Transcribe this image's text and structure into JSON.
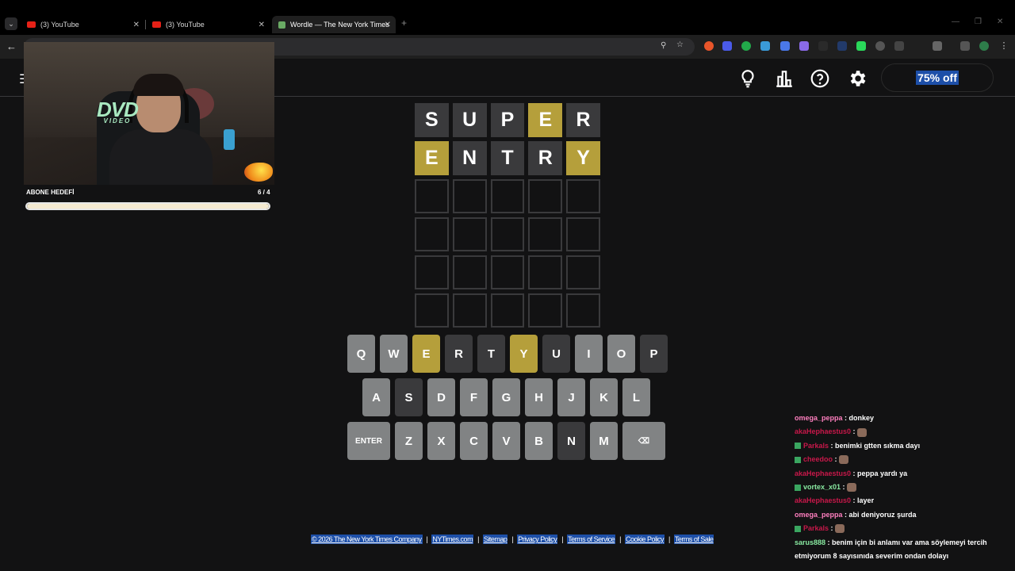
{
  "browser": {
    "tabs": [
      {
        "title": "(3) YouTube",
        "favicon_color": "#e62117"
      },
      {
        "title": "(3) YouTube",
        "favicon_color": "#e62117"
      },
      {
        "title": "Wordle — The New York Times",
        "favicon_color": "#6aaa64",
        "active": true
      }
    ]
  },
  "header": {
    "offer_label": "75% off"
  },
  "colors": {
    "correct": "#b59f3b",
    "present": "#b59f3b",
    "absent": "#3a3a3c",
    "unused_key": "#818384",
    "background": "#121213"
  },
  "board": {
    "rows": [
      {
        "letters": [
          "S",
          "U",
          "P",
          "E",
          "R"
        ],
        "states": [
          "absent",
          "absent",
          "absent",
          "present",
          "absent"
        ]
      },
      {
        "letters": [
          "E",
          "N",
          "T",
          "R",
          "Y"
        ],
        "states": [
          "present",
          "absent",
          "absent",
          "absent",
          "present"
        ]
      },
      {
        "letters": [
          "",
          "",
          "",
          "",
          ""
        ],
        "states": [
          "empty",
          "empty",
          "empty",
          "empty",
          "empty"
        ]
      },
      {
        "letters": [
          "",
          "",
          "",
          "",
          ""
        ],
        "states": [
          "empty",
          "empty",
          "empty",
          "empty",
          "empty"
        ]
      },
      {
        "letters": [
          "",
          "",
          "",
          "",
          ""
        ],
        "states": [
          "empty",
          "empty",
          "empty",
          "empty",
          "empty"
        ]
      },
      {
        "letters": [
          "",
          "",
          "",
          "",
          ""
        ],
        "states": [
          "empty",
          "empty",
          "empty",
          "empty",
          "empty"
        ]
      }
    ]
  },
  "keyboard": {
    "rows": [
      [
        {
          "k": "Q",
          "s": "unused"
        },
        {
          "k": "W",
          "s": "unused"
        },
        {
          "k": "E",
          "s": "present"
        },
        {
          "k": "R",
          "s": "absent"
        },
        {
          "k": "T",
          "s": "absent"
        },
        {
          "k": "Y",
          "s": "present"
        },
        {
          "k": "U",
          "s": "absent"
        },
        {
          "k": "I",
          "s": "unused"
        },
        {
          "k": "O",
          "s": "unused"
        },
        {
          "k": "P",
          "s": "absent"
        }
      ],
      [
        {
          "k": "A",
          "s": "unused"
        },
        {
          "k": "S",
          "s": "absent"
        },
        {
          "k": "D",
          "s": "unused"
        },
        {
          "k": "F",
          "s": "unused"
        },
        {
          "k": "G",
          "s": "unused"
        },
        {
          "k": "H",
          "s": "unused"
        },
        {
          "k": "J",
          "s": "unused"
        },
        {
          "k": "K",
          "s": "unused"
        },
        {
          "k": "L",
          "s": "unused"
        }
      ],
      [
        {
          "k": "ENTER",
          "s": "unused",
          "wide": true
        },
        {
          "k": "Z",
          "s": "unused"
        },
        {
          "k": "X",
          "s": "unused"
        },
        {
          "k": "C",
          "s": "unused"
        },
        {
          "k": "V",
          "s": "unused"
        },
        {
          "k": "B",
          "s": "unused"
        },
        {
          "k": "N",
          "s": "absent"
        },
        {
          "k": "M",
          "s": "unused"
        },
        {
          "k": "⌫",
          "s": "unused",
          "wide": true
        }
      ]
    ]
  },
  "stream": {
    "logo_text": "DVD",
    "logo_sub": "VIDEO",
    "goal_label": "ABONE HEDEFİ",
    "goal_count": "6 / 4",
    "goal_progress": 1.0
  },
  "chat": [
    {
      "user": "omega_peppa",
      "color": "#ff7fbf",
      "text": "donkey"
    },
    {
      "user": "akaHephaestus0",
      "color": "#c8184a",
      "text": "",
      "emote": true
    },
    {
      "user": "Parkals",
      "color": "#c8184a",
      "badge": true,
      "text": "benimki gtten sıkma dayı"
    },
    {
      "user": "cheedoo",
      "color": "#c8184a",
      "badge": true,
      "text": "",
      "emote": true
    },
    {
      "user": "akaHephaestus0",
      "color": "#c8184a",
      "text": "peppa yardı ya"
    },
    {
      "user": "vortex_x01",
      "color": "#88e8a0",
      "badge": true,
      "text": "",
      "emote": true
    },
    {
      "user": "akaHephaestus0",
      "color": "#c8184a",
      "text": "layer"
    },
    {
      "user": "omega_peppa",
      "color": "#ff7fbf",
      "text": "abi deniyoruz şurda"
    },
    {
      "user": "Parkals",
      "color": "#c8184a",
      "badge": true,
      "text": "",
      "emote": true
    },
    {
      "user": "sarus888",
      "color": "#88e8a0",
      "text": "benim için bi anlamı var ama söylemeyi tercih etmiyorum 8 sayısınıda severim ondan dolayı"
    }
  ],
  "footer": {
    "links": [
      "© 2026 The New York Times Company",
      "NYTimes.com",
      "Sitemap",
      "Privacy Policy",
      "Terms of Service",
      "Cookie Policy",
      "Terms of Sale"
    ]
  }
}
